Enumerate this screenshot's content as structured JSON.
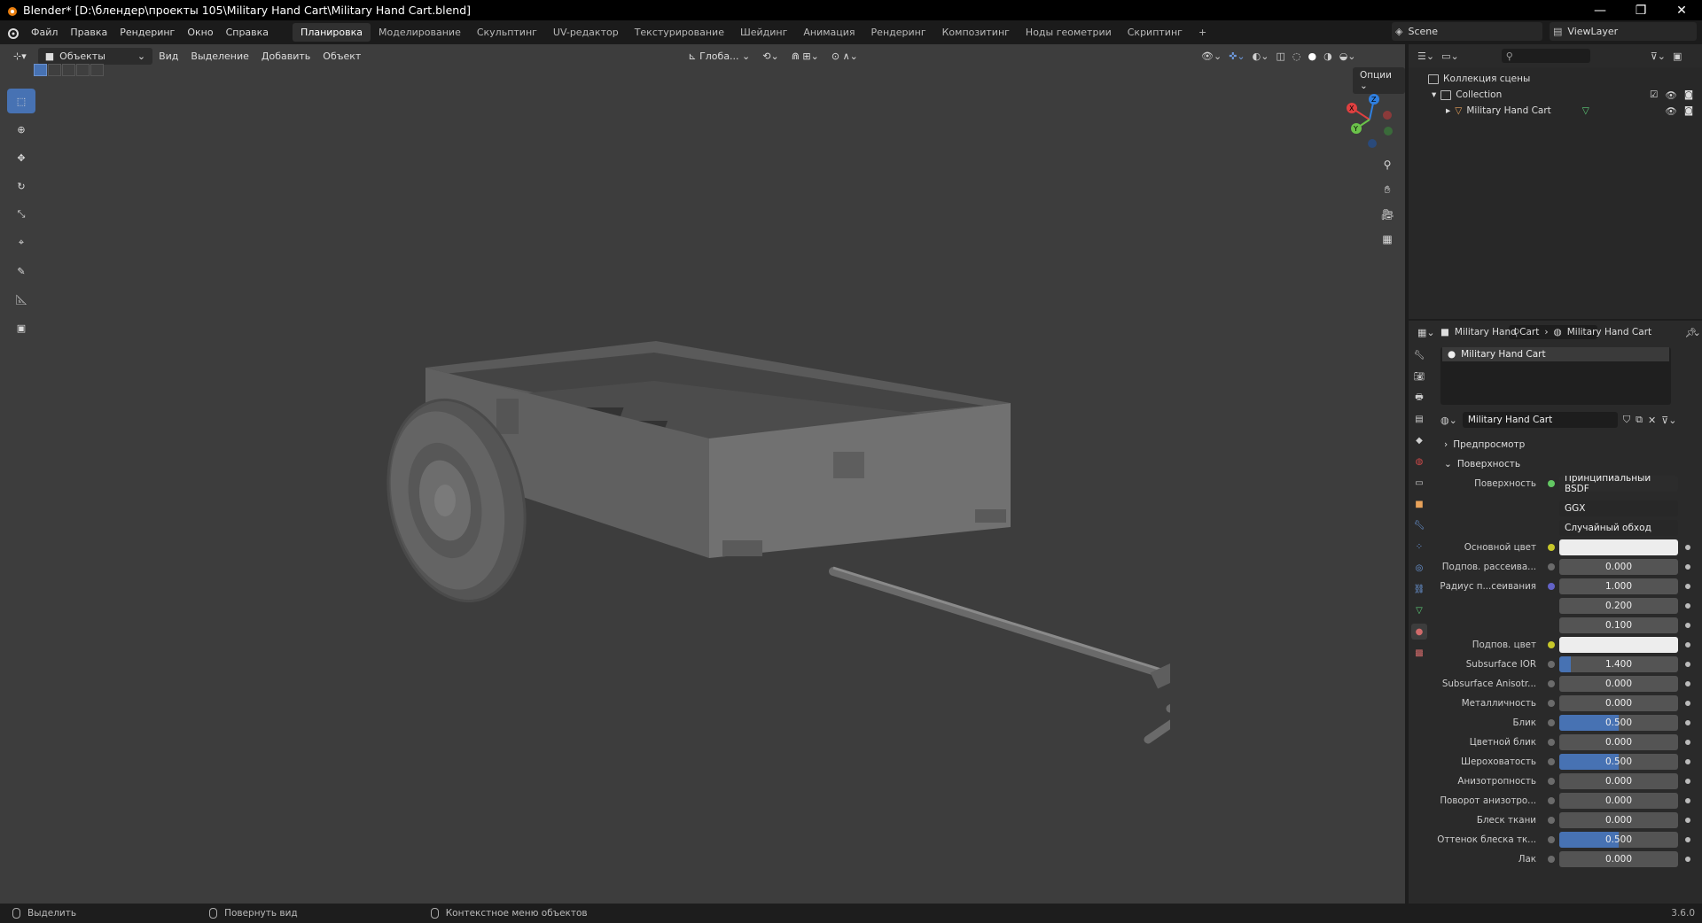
{
  "window": {
    "title": "Blender* [D:\\блендер\\проекты 105\\Military Hand Cart\\Military Hand Cart.blend]",
    "controls": [
      "—",
      "❐",
      "✕"
    ]
  },
  "menu": [
    "Файл",
    "Правка",
    "Рендеринг",
    "Окно",
    "Справка"
  ],
  "workspaces": [
    "Планировка",
    "Моделирование",
    "Скульптинг",
    "UV-редактор",
    "Текстурирование",
    "Шейдинг",
    "Анимация",
    "Рендеринг",
    "Композитинг",
    "Ноды геометрии",
    "Скриптинг",
    "+"
  ],
  "active_workspace": "Планировка",
  "scene": {
    "name": "Scene",
    "view_layer": "ViewLayer"
  },
  "viewport": {
    "mode": "Объекты",
    "menus": [
      "Вид",
      "Выделение",
      "Добавить",
      "Объект"
    ],
    "transform_orientation": "Глоба...",
    "options_label": "Опции",
    "gizmo": {
      "x": "X",
      "y": "Y",
      "z": "Z"
    }
  },
  "outliner": {
    "scene_collection": "Коллекция сцены",
    "collection": "Collection",
    "object": "Military Hand Cart"
  },
  "properties": {
    "breadcrumb_object": "Military Hand Cart",
    "breadcrumb_material": "Military Hand Cart",
    "slot": "Military Hand Cart",
    "material_name": "Military Hand Cart",
    "sections": {
      "preview": "Предпросмотр",
      "surface": "Поверхность"
    },
    "surface_label": "Поверхность",
    "surface_shader": "Принципиальный BSDF",
    "distribution": "GGX",
    "subsurface_method": "Случайный обход",
    "rows": [
      {
        "label": "Основной цвет",
        "value": "",
        "type": "color"
      },
      {
        "label": "Подпов. рассеива...",
        "value": "0.000",
        "fill": 0
      },
      {
        "label": "Радиус п...сеивания",
        "value": "1.000",
        "fill": 0
      },
      {
        "label": "",
        "value": "0.200",
        "fill": 0
      },
      {
        "label": "",
        "value": "0.100",
        "fill": 0
      },
      {
        "label": "Подпов. цвет",
        "value": "",
        "type": "color"
      },
      {
        "label": "Subsurface IOR",
        "value": "1.400",
        "fill": 0.1
      },
      {
        "label": "Subsurface Anisotr...",
        "value": "0.000",
        "fill": 0
      },
      {
        "label": "Металличность",
        "value": "0.000",
        "fill": 0
      },
      {
        "label": "Блик",
        "value": "0.500",
        "fill": 0.5
      },
      {
        "label": "Цветной блик",
        "value": "0.000",
        "fill": 0
      },
      {
        "label": "Шероховатость",
        "value": "0.500",
        "fill": 0.5
      },
      {
        "label": "Анизотропность",
        "value": "0.000",
        "fill": 0
      },
      {
        "label": "Поворот анизотро...",
        "value": "0.000",
        "fill": 0
      },
      {
        "label": "Блеск ткани",
        "value": "0.000",
        "fill": 0
      },
      {
        "label": "Оттенок блеска тк...",
        "value": "0.500",
        "fill": 0.5
      },
      {
        "label": "Лак",
        "value": "0.000",
        "fill": 0
      }
    ]
  },
  "statusbar": {
    "select": "Выделить",
    "rotate": "Повернуть вид",
    "context": "Контекстное меню объектов",
    "version": "3.6.0"
  },
  "colors": {
    "accent": "#4772b3",
    "viewport_bg": "#3d3d3d",
    "panel_bg": "#2a2a2a"
  }
}
